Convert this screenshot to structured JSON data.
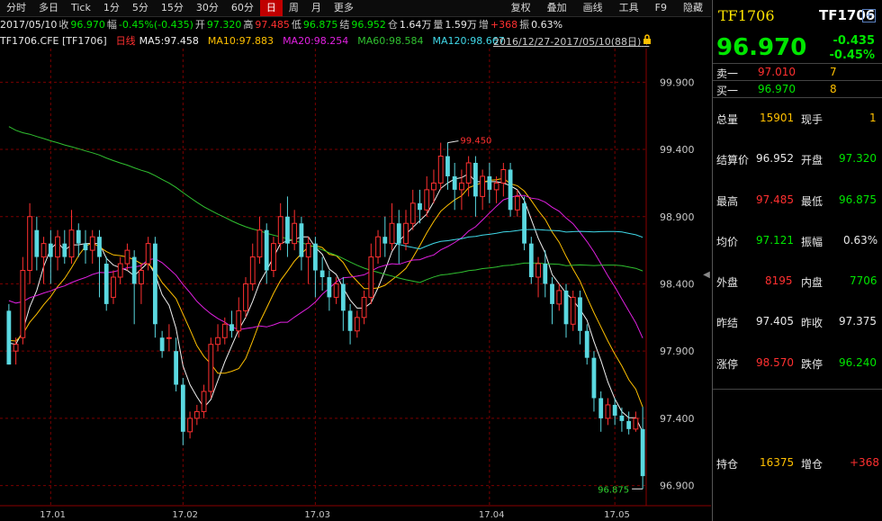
{
  "toolbar": {
    "items": [
      "分时",
      "多日",
      "Tick",
      "1分",
      "5分",
      "15分",
      "30分",
      "60分",
      "日",
      "周",
      "月",
      "更多"
    ],
    "active_index": 8,
    "right_items": [
      "复权",
      "叠加",
      "画线",
      "工具",
      "F9",
      "隐藏"
    ]
  },
  "infobar": {
    "date": "2017/05/10",
    "close_label": "收",
    "close": "96.970",
    "change_label": "幅",
    "change": "-0.45%(-0.435)",
    "open_label": "开",
    "open": "97.320",
    "high_label": "高",
    "high": "97.485",
    "low_label": "低",
    "low": "96.875",
    "settle_label": "结",
    "settle": "96.952",
    "oi_label": "仓",
    "oi": "1.64万",
    "volume_label": "量",
    "volume": "1.59万",
    "inc_label": "增",
    "inc": "+368",
    "amp_label": "振",
    "amp": "0.63%"
  },
  "maline": {
    "symbol": "TF1706.CFE [TF1706]",
    "period": "日线",
    "ma5": "MA5:97.458",
    "ma10": "MA10:97.883",
    "ma20": "MA20:98.254",
    "ma60": "MA60:98.584",
    "ma120": "MA120:98.667",
    "range": "2016/12/27-2017/05/10(88日)"
  },
  "colors": {
    "up": "#ff3030",
    "down": "#5ad8e0",
    "ma5": "#f0f0f0",
    "ma10": "#ffc000",
    "ma20": "#e020e0",
    "ma60": "#30c030",
    "ma120": "#40d8e8",
    "grid": "#7a0000"
  },
  "chart_data": {
    "type": "candlestick",
    "y_ticks": [
      "99.900",
      "99.400",
      "98.900",
      "98.400",
      "97.900",
      "97.400",
      "96.900"
    ],
    "ylim": [
      96.75,
      100.15
    ],
    "x_ticks": [
      "17.01",
      "17.02",
      "17.03",
      "17.04",
      "17.05"
    ],
    "x_tick_index": [
      6,
      25,
      44,
      69,
      87
    ],
    "high_annotation": "99.450",
    "high_index": 63,
    "low_annotation": "96.875",
    "low_index": 91,
    "candles": [
      [
        98.2,
        97.8,
        98.25,
        97.8
      ],
      [
        97.9,
        97.95,
        98.0,
        97.8
      ],
      [
        98.0,
        98.5,
        98.6,
        97.95
      ],
      [
        98.5,
        98.9,
        99.0,
        98.4
      ],
      [
        98.8,
        98.6,
        98.9,
        98.5
      ],
      [
        98.6,
        98.7,
        98.75,
        98.4
      ],
      [
        98.7,
        98.6,
        98.8,
        98.4
      ],
      [
        98.6,
        98.75,
        98.8,
        98.5
      ],
      [
        98.7,
        98.6,
        98.8,
        98.55
      ],
      [
        98.6,
        98.8,
        98.95,
        98.55
      ],
      [
        98.8,
        98.7,
        98.85,
        98.6
      ],
      [
        98.7,
        98.65,
        98.8,
        98.55
      ],
      [
        98.65,
        98.75,
        98.8,
        98.55
      ],
      [
        98.75,
        98.6,
        98.8,
        98.3
      ],
      [
        98.55,
        98.25,
        98.6,
        98.2
      ],
      [
        98.3,
        98.45,
        98.5,
        98.25
      ],
      [
        98.45,
        98.55,
        98.6,
        98.4
      ],
      [
        98.55,
        98.65,
        98.7,
        98.5
      ],
      [
        98.6,
        98.4,
        98.65,
        98.1
      ],
      [
        98.4,
        98.5,
        98.55,
        98.25
      ],
      [
        98.55,
        98.7,
        98.75,
        98.5
      ],
      [
        98.7,
        98.1,
        98.75,
        98.0
      ],
      [
        98.0,
        97.9,
        98.05,
        97.85
      ],
      [
        98.0,
        98.0,
        98.1,
        97.9
      ],
      [
        97.9,
        97.65,
        98.0,
        97.6
      ],
      [
        97.65,
        97.3,
        97.7,
        97.2
      ],
      [
        97.3,
        97.4,
        97.45,
        97.25
      ],
      [
        97.4,
        97.45,
        97.5,
        97.35
      ],
      [
        97.45,
        97.6,
        97.65,
        97.4
      ],
      [
        97.6,
        97.95,
        98.0,
        97.55
      ],
      [
        97.95,
        98.0,
        98.1,
        97.9
      ],
      [
        98.0,
        98.1,
        98.15,
        97.95
      ],
      [
        98.1,
        98.05,
        98.2,
        98.0
      ],
      [
        98.05,
        98.2,
        98.3,
        98.0
      ],
      [
        98.2,
        98.4,
        98.45,
        98.15
      ],
      [
        98.4,
        98.6,
        98.7,
        98.35
      ],
      [
        98.6,
        98.8,
        98.9,
        98.55
      ],
      [
        98.8,
        98.5,
        98.85,
        98.4
      ],
      [
        98.5,
        98.7,
        98.75,
        98.45
      ],
      [
        98.7,
        98.9,
        99.0,
        98.65
      ],
      [
        98.9,
        98.7,
        99.05,
        98.6
      ],
      [
        98.7,
        98.85,
        98.95,
        98.65
      ],
      [
        98.85,
        98.6,
        98.9,
        98.5
      ],
      [
        98.6,
        98.7,
        98.75,
        98.4
      ],
      [
        98.7,
        98.5,
        98.75,
        98.3
      ],
      [
        98.5,
        98.45,
        98.6,
        98.35
      ],
      [
        98.45,
        98.3,
        98.5,
        98.2
      ],
      [
        98.3,
        98.4,
        98.45,
        98.25
      ],
      [
        98.4,
        98.2,
        98.45,
        98.05
      ],
      [
        98.2,
        98.05,
        98.25,
        97.95
      ],
      [
        98.05,
        98.15,
        98.2,
        98.0
      ],
      [
        98.15,
        98.3,
        98.35,
        98.1
      ],
      [
        98.3,
        98.6,
        98.7,
        98.25
      ],
      [
        98.6,
        98.75,
        98.8,
        98.55
      ],
      [
        98.75,
        98.7,
        98.9,
        98.6
      ],
      [
        98.7,
        98.85,
        99.0,
        98.65
      ],
      [
        98.85,
        98.7,
        98.95,
        98.55
      ],
      [
        98.7,
        98.85,
        98.95,
        98.65
      ],
      [
        98.85,
        99.0,
        99.1,
        98.8
      ],
      [
        99.0,
        98.95,
        99.1,
        98.85
      ],
      [
        98.95,
        99.1,
        99.2,
        98.9
      ],
      [
        99.1,
        99.15,
        99.25,
        99.0
      ],
      [
        99.15,
        99.35,
        99.45,
        99.1
      ],
      [
        99.35,
        99.2,
        99.45,
        99.1
      ],
      [
        99.2,
        99.1,
        99.3,
        98.95
      ],
      [
        99.1,
        99.15,
        99.25,
        98.95
      ],
      [
        99.15,
        99.3,
        99.35,
        99.05
      ],
      [
        99.3,
        99.05,
        99.35,
        98.9
      ],
      [
        99.05,
        99.2,
        99.25,
        98.95
      ],
      [
        99.2,
        99.1,
        99.3,
        99.0
      ],
      [
        99.1,
        99.15,
        99.2,
        99.0
      ],
      [
        99.15,
        99.25,
        99.3,
        99.05
      ],
      [
        99.25,
        98.95,
        99.3,
        98.9
      ],
      [
        98.95,
        99.05,
        99.1,
        98.9
      ],
      [
        99.0,
        98.7,
        99.05,
        98.65
      ],
      [
        98.7,
        98.45,
        98.75,
        98.4
      ],
      [
        98.45,
        98.55,
        98.6,
        98.3
      ],
      [
        98.55,
        98.4,
        98.65,
        98.3
      ],
      [
        98.4,
        98.25,
        98.45,
        98.1
      ],
      [
        98.25,
        98.35,
        98.4,
        98.2
      ],
      [
        98.35,
        98.1,
        98.4,
        98.0
      ],
      [
        98.1,
        98.3,
        98.35,
        98.05
      ],
      [
        98.3,
        98.05,
        98.35,
        97.95
      ],
      [
        98.05,
        97.85,
        98.1,
        97.8
      ],
      [
        97.85,
        97.55,
        97.9,
        97.45
      ],
      [
        97.55,
        97.4,
        97.6,
        97.3
      ],
      [
        97.4,
        97.5,
        97.55,
        97.35
      ],
      [
        97.5,
        97.42,
        97.55,
        97.35
      ],
      [
        97.42,
        97.38,
        97.48,
        97.3
      ],
      [
        97.38,
        97.32,
        97.45,
        97.28
      ],
      [
        97.32,
        97.4,
        97.45,
        97.3
      ],
      [
        97.32,
        96.97,
        97.485,
        96.875
      ]
    ]
  },
  "quote": {
    "code": "TF1706",
    "code2": "TF1706",
    "price": "96.970",
    "change": "-0.435",
    "change_pct": "-0.45%",
    "ask_label": "卖一",
    "ask": "97.010",
    "ask_vol": "7",
    "bid_label": "买一",
    "bid": "96.970",
    "bid_vol": "8",
    "total_vol_label": "总量",
    "total_vol": "15901",
    "cur_vol_label": "现手",
    "cur_vol": "1",
    "settle_label": "结算价",
    "settle": "96.952",
    "open_label": "开盘",
    "open": "97.320",
    "high_label": "最高",
    "high": "97.485",
    "low_label": "最低",
    "low": "96.875",
    "avg_label": "均价",
    "avg": "97.121",
    "amp_label": "振幅",
    "amp": "0.63%",
    "outer_label": "外盘",
    "outer": "8195",
    "inner_label": "内盘",
    "inner": "7706",
    "prev_settle_label": "昨结",
    "prev_settle": "97.405",
    "prev_close_label": "昨收",
    "prev_close": "97.375",
    "limit_up_label": "涨停",
    "limit_up": "98.570",
    "limit_down_label": "跌停",
    "limit_down": "96.240",
    "oi_label": "持仓",
    "oi": "16375",
    "oi_inc_label": "增仓",
    "oi_inc": "+368"
  }
}
